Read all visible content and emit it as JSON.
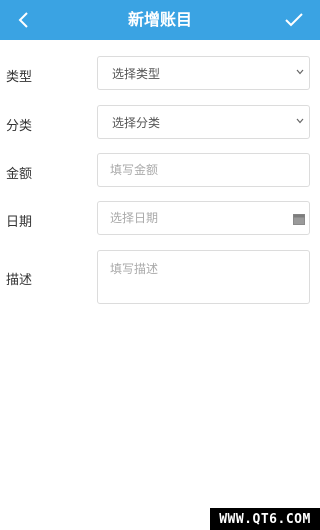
{
  "header": {
    "title": "新增账目",
    "back_icon": "chevron-left-icon",
    "confirm_icon": "check-icon",
    "bg_color": "#3aa3e3"
  },
  "form": {
    "type": {
      "label": "类型",
      "selected": "选择类型"
    },
    "category": {
      "label": "分类",
      "selected": "选择分类"
    },
    "amount": {
      "label": "金额",
      "placeholder": "填写金额"
    },
    "date": {
      "label": "日期",
      "placeholder": "选择日期"
    },
    "description": {
      "label": "描述",
      "placeholder": "填写描述"
    }
  },
  "watermark": {
    "text": "WWW.QT6.COM"
  }
}
